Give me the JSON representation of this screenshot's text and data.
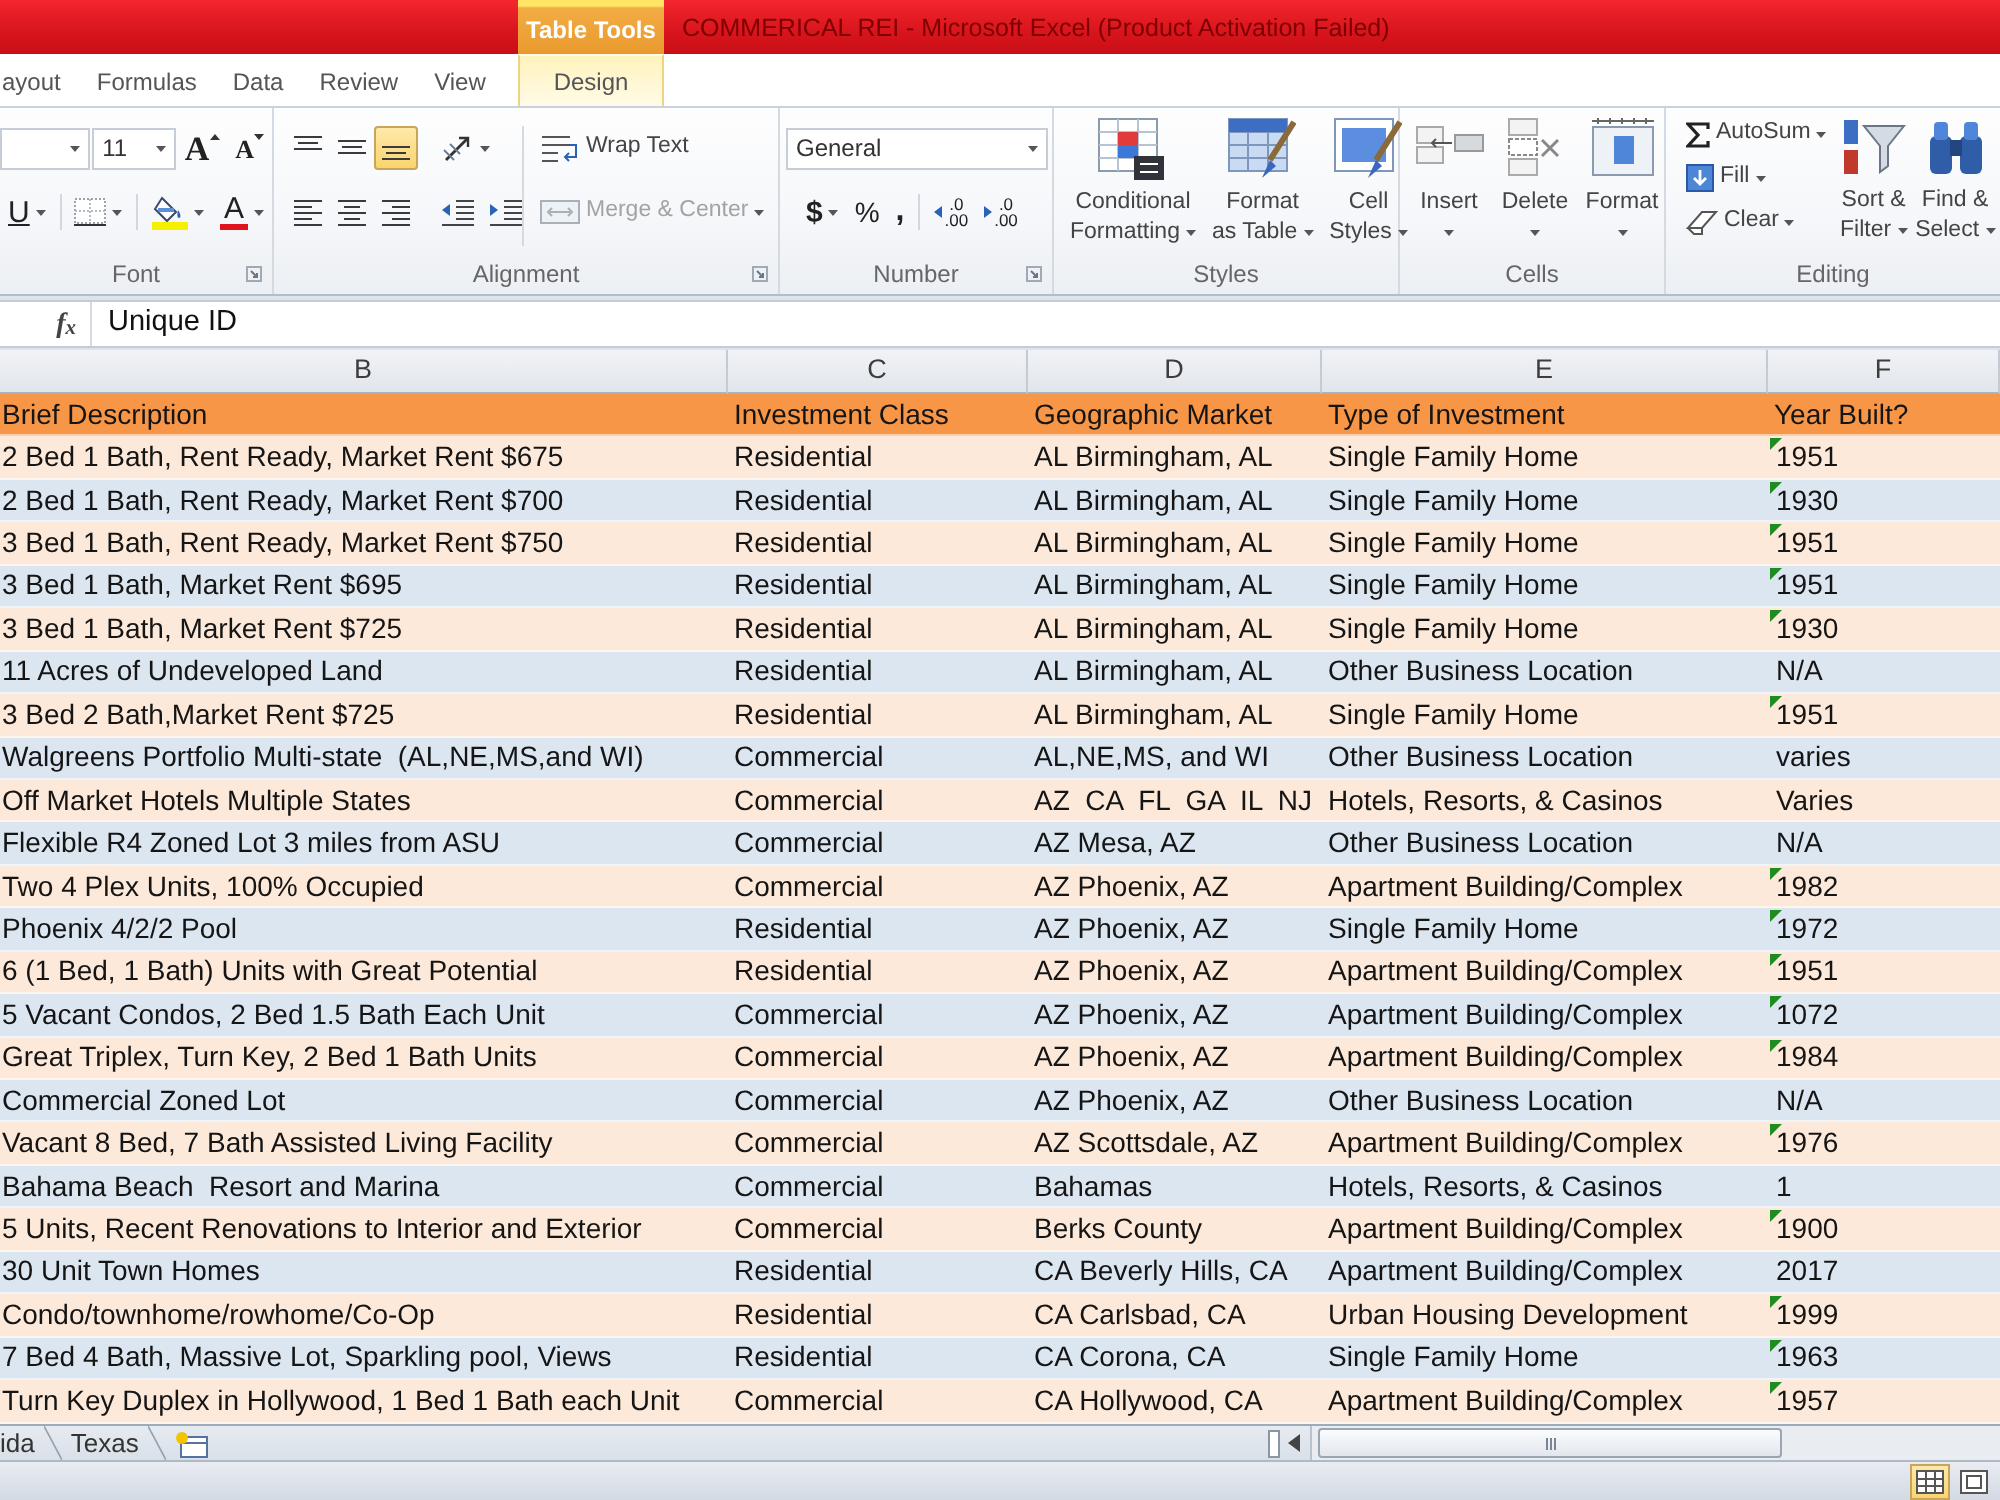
{
  "title_bar": {
    "contextual_tab": "Table Tools",
    "title": "COMMERICAL REI - Microsoft Excel (Product Activation Failed)"
  },
  "ribbon_tabs": [
    {
      "label": "ayout",
      "kind": "standard",
      "selected": false
    },
    {
      "label": "Formulas",
      "kind": "standard",
      "selected": false
    },
    {
      "label": "Data",
      "kind": "standard",
      "selected": false
    },
    {
      "label": "Review",
      "kind": "standard",
      "selected": false
    },
    {
      "label": "View",
      "kind": "standard",
      "selected": false
    },
    {
      "label": "Design",
      "kind": "contextual",
      "selected": false
    }
  ],
  "font_group": {
    "label": "Font",
    "font_size": "11",
    "grow": "A",
    "shrink": "A",
    "underline": "U",
    "font_color": "A"
  },
  "alignment_group": {
    "label": "Alignment",
    "vertical": [
      {
        "kind": "top",
        "selected": false
      },
      {
        "kind": "middle",
        "selected": false
      },
      {
        "kind": "bottom",
        "selected": true
      }
    ],
    "horizontal": [
      {
        "kind": "left",
        "selected": false
      },
      {
        "kind": "center",
        "selected": false
      },
      {
        "kind": "right",
        "selected": false
      }
    ],
    "wrap_text": "Wrap Text",
    "merge": {
      "label": "Merge & Center",
      "disabled": true
    }
  },
  "number_group": {
    "label": "Number",
    "format": "General",
    "symbols": [
      {
        "kind": "currency",
        "text": "$"
      },
      {
        "kind": "percent",
        "text": "%"
      },
      {
        "kind": "comma",
        "text": ","
      }
    ],
    "decimals": [
      {
        "kind": "increase",
        "lines": [
          ".0",
          ".00"
        ]
      },
      {
        "kind": "decrease",
        "lines": [
          ".0",
          ".00"
        ]
      }
    ]
  },
  "styles_group": {
    "label": "Styles",
    "buttons": [
      {
        "kind": "conditional_formatting",
        "lines": [
          "Conditional",
          "Formatting"
        ]
      },
      {
        "kind": "format_as_table",
        "lines": [
          "Format",
          "as Table"
        ]
      },
      {
        "kind": "cell_styles",
        "lines": [
          "Cell",
          "Styles"
        ]
      }
    ]
  },
  "cells_group": {
    "label": "Cells",
    "buttons": [
      {
        "kind": "insert",
        "label": "Insert"
      },
      {
        "kind": "delete",
        "label": "Delete"
      },
      {
        "kind": "format",
        "label": "Format"
      }
    ]
  },
  "editing_group": {
    "label": "Editing",
    "small_buttons": [
      {
        "kind": "autosum",
        "label": "AutoSum"
      },
      {
        "kind": "fill",
        "label": "Fill"
      },
      {
        "kind": "clear",
        "label": "Clear"
      }
    ],
    "large_buttons": [
      {
        "kind": "sort_filter",
        "lines": [
          "Sort &",
          "Filter"
        ]
      },
      {
        "kind": "find_select",
        "lines": [
          "Find &",
          "Select"
        ]
      }
    ]
  },
  "formula_bar": {
    "function_label": "f$_{x}$",
    "value": "Unique ID"
  },
  "column_letters": [
    "B",
    "C",
    "D",
    "E",
    "F"
  ],
  "table": {
    "columns": [
      "Brief Description",
      "Investment Class",
      "Geographic Market",
      "Type of Investment",
      "Year Built?"
    ],
    "rows": [
      {
        "cells": [
          "2 Bed 1 Bath, Rent Ready, Market Rent $675",
          "Residential",
          "AL Birmingham, AL",
          "Single Family Home",
          "1951"
        ],
        "error_flag": true
      },
      {
        "cells": [
          "2 Bed 1 Bath, Rent Ready, Market Rent $700",
          "Residential",
          "AL Birmingham, AL",
          "Single Family Home",
          "1930"
        ],
        "error_flag": true
      },
      {
        "cells": [
          "3 Bed 1 Bath, Rent Ready, Market Rent $750",
          "Residential",
          "AL Birmingham, AL",
          "Single Family Home",
          "1951"
        ],
        "error_flag": true
      },
      {
        "cells": [
          "3 Bed 1 Bath, Market Rent $695",
          "Residential",
          "AL Birmingham, AL",
          "Single Family Home",
          "1951"
        ],
        "error_flag": true
      },
      {
        "cells": [
          "3 Bed 1 Bath, Market Rent $725",
          "Residential",
          "AL Birmingham, AL",
          "Single Family Home",
          "1930"
        ],
        "error_flag": true
      },
      {
        "cells": [
          "11 Acres of Undeveloped Land",
          "Residential",
          "AL Birmingham, AL",
          "Other Business Location",
          "N/A"
        ],
        "error_flag": false
      },
      {
        "cells": [
          "3 Bed 2 Bath,Market Rent $725",
          "Residential",
          "AL Birmingham, AL",
          "Single Family Home",
          "1951"
        ],
        "error_flag": true
      },
      {
        "cells": [
          "Walgreens Portfolio Multi-state  (AL,NE,MS,and WI)",
          "Commercial",
          "AL,NE,MS, and WI",
          "Other Business Location",
          "varies"
        ],
        "error_flag": false
      },
      {
        "cells": [
          "Off Market Hotels Multiple States",
          "Commercial",
          "AZ  CA  FL  GA  IL  NJ",
          "Hotels, Resorts, & Casinos",
          "Varies"
        ],
        "error_flag": false
      },
      {
        "cells": [
          "Flexible R4 Zoned Lot 3 miles from ASU",
          "Commercial",
          "AZ Mesa, AZ",
          "Other Business Location",
          "N/A"
        ],
        "error_flag": false
      },
      {
        "cells": [
          "Two 4 Plex Units, 100% Occupied",
          "Commercial",
          "AZ Phoenix, AZ",
          "Apartment Building/Complex",
          "1982"
        ],
        "error_flag": true
      },
      {
        "cells": [
          "Phoenix 4/2/2 Pool",
          "Residential",
          "AZ Phoenix, AZ",
          "Single Family Home",
          "1972"
        ],
        "error_flag": true
      },
      {
        "cells": [
          "6 (1 Bed, 1 Bath) Units with Great Potential",
          "Residential",
          "AZ Phoenix, AZ",
          "Apartment Building/Complex",
          "1951"
        ],
        "error_flag": true
      },
      {
        "cells": [
          "5 Vacant Condos, 2 Bed 1.5 Bath Each Unit",
          "Commercial",
          "AZ Phoenix, AZ",
          "Apartment Building/Complex",
          "1072"
        ],
        "error_flag": true
      },
      {
        "cells": [
          "Great Triplex, Turn Key, 2 Bed 1 Bath Units",
          "Commercial",
          "AZ Phoenix, AZ",
          "Apartment Building/Complex",
          "1984"
        ],
        "error_flag": true
      },
      {
        "cells": [
          "Commercial Zoned Lot",
          "Commercial",
          "AZ Phoenix, AZ",
          "Other Business Location",
          "N/A"
        ],
        "error_flag": false
      },
      {
        "cells": [
          "Vacant 8 Bed, 7 Bath Assisted Living Facility",
          "Commercial",
          "AZ Scottsdale, AZ",
          "Apartment Building/Complex",
          "1976"
        ],
        "error_flag": true
      },
      {
        "cells": [
          "Bahama Beach  Resort and Marina",
          "Commercial",
          "Bahamas",
          "Hotels, Resorts, & Casinos",
          "1"
        ],
        "error_flag": false
      },
      {
        "cells": [
          "5 Units, Recent Renovations to Interior and Exterior",
          "Commercial",
          "Berks County",
          "Apartment Building/Complex",
          "1900"
        ],
        "error_flag": true
      },
      {
        "cells": [
          "30 Unit Town Homes",
          "Residential",
          "CA Beverly Hills, CA",
          "Apartment Building/Complex",
          "2017"
        ],
        "error_flag": false
      },
      {
        "cells": [
          "Condo/townhome/rowhome/Co-Op",
          "Residential",
          "CA Carlsbad, CA",
          "Urban Housing Development",
          "1999"
        ],
        "error_flag": true
      },
      {
        "cells": [
          "7 Bed 4 Bath, Massive Lot, Sparkling pool, Views",
          "Residential",
          "CA Corona, CA",
          "Single Family Home",
          "1963"
        ],
        "error_flag": true
      },
      {
        "cells": [
          "Turn Key Duplex in Hollywood, 1 Bed 1 Bath each Unit",
          "Commercial",
          "CA Hollywood, CA",
          "Apartment Building/Complex",
          "1957"
        ],
        "error_flag": true
      }
    ]
  },
  "sheet_tabs": [
    {
      "label": "ida",
      "selected": false
    },
    {
      "label": "Texas",
      "selected": false
    }
  ],
  "status_bar": {
    "views": [
      {
        "kind": "normal",
        "selected": true
      },
      {
        "kind": "page_layout",
        "selected": false
      }
    ]
  }
}
